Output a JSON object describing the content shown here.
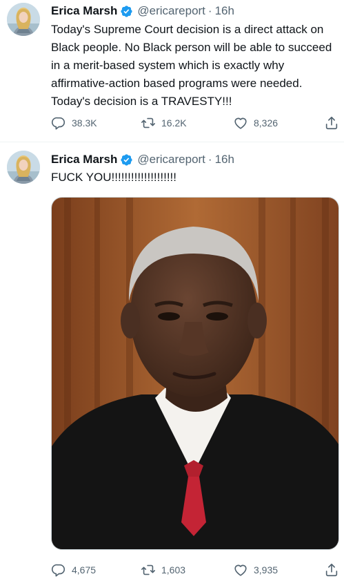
{
  "colors": {
    "text_primary": "#0f1419",
    "text_secondary": "#536471",
    "verified_blue": "#1d9bf0",
    "divider": "#eff3f4"
  },
  "icons": {
    "verified": "verified-badge-icon",
    "reply": "reply-icon",
    "retweet": "retweet-icon",
    "like": "heart-icon",
    "share": "share-icon"
  },
  "tweets": [
    {
      "author": {
        "name": "Erica Marsh",
        "handle": "@ericareport"
      },
      "separator": "·",
      "time": "16h",
      "text": "Today's Supreme Court decision is a direct attack on Black people. No Black person will be able to succeed in a merit-based system which is exactly why affirmative-action based programs were needed. Today's decision is a TRAVESTY!!!",
      "stats": {
        "replies": "38.3K",
        "retweets": "16.2K",
        "likes": "8,326"
      }
    },
    {
      "author": {
        "name": "Erica Marsh",
        "handle": "@ericareport"
      },
      "separator": "·",
      "time": "16h",
      "text": "FUCK YOU!!!!!!!!!!!!!!!!!!!!",
      "stats": {
        "replies": "4,675",
        "retweets": "1,603",
        "likes": "3,935"
      }
    }
  ]
}
